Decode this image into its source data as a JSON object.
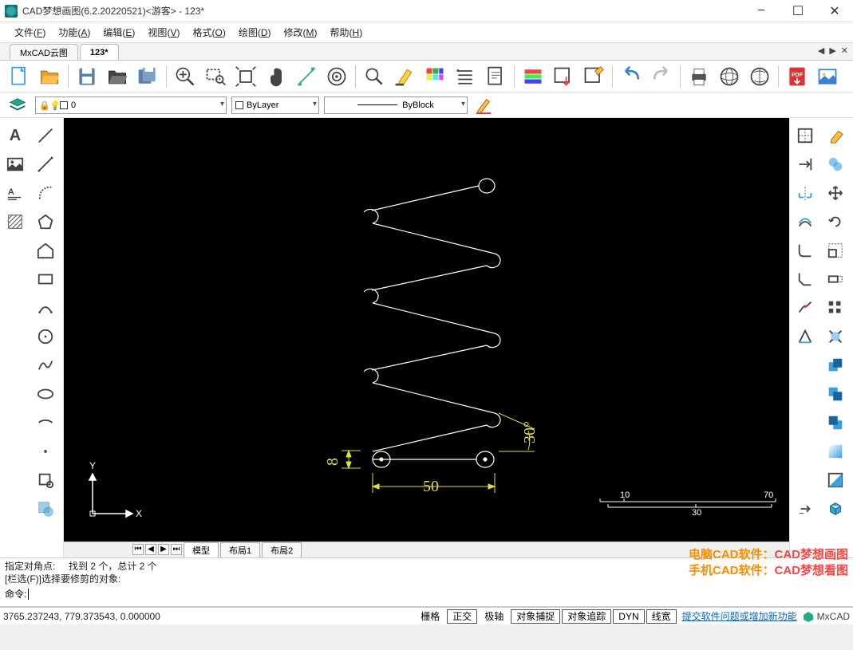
{
  "titlebar": {
    "title": "CAD梦想画图(6.2.20220521)<游客>  -  123*"
  },
  "menubar": {
    "items": [
      {
        "label": "文件",
        "key": "F"
      },
      {
        "label": "功能",
        "key": "A"
      },
      {
        "label": "编辑",
        "key": "E"
      },
      {
        "label": "视图",
        "key": "V"
      },
      {
        "label": "格式",
        "key": "O"
      },
      {
        "label": "绘图",
        "key": "D"
      },
      {
        "label": "修改",
        "key": "M"
      },
      {
        "label": "帮助",
        "key": "H"
      }
    ]
  },
  "doctabs": {
    "tabs": [
      {
        "label": "MxCAD云图"
      },
      {
        "label": "123*"
      }
    ],
    "active": 1
  },
  "toolbar2": {
    "layer_text": "0",
    "bylayer_text": "ByLayer",
    "byblock_text": "ByBlock"
  },
  "canvas": {
    "dims": {
      "width": "50",
      "height": "8",
      "angle": "30°"
    },
    "axis": {
      "x": "X",
      "y": "Y"
    },
    "ruler": {
      "t10": "10",
      "t70": "70",
      "t30": "30"
    }
  },
  "btabs": {
    "model": "模型",
    "l1": "布局1",
    "l2": "布局2"
  },
  "command": {
    "line1": "指定对角点:     找到 2 个，总计 2 个",
    "line2": "[栏选(F)]选择要修剪的对象:",
    "prompt": "命令:"
  },
  "promo": {
    "line1a": "电脑CAD软件：",
    "line1b": "CAD梦想画图",
    "line2a": "手机CAD软件：",
    "line2b": "CAD梦想看图"
  },
  "status": {
    "coords": "3765.237243,  779.373543,  0.000000",
    "buttons": {
      "grid": "栅格",
      "ortho": "正交",
      "polar": "极轴",
      "osnap": "对象捕捉",
      "otrack": "对象追踪",
      "dyn": "DYN",
      "lw": "线宽"
    },
    "feedback": "提交软件问题或增加新功能",
    "brand": "MxCAD"
  }
}
